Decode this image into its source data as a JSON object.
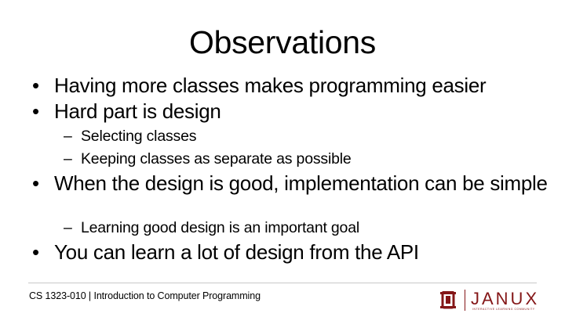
{
  "slide": {
    "title": "Observations",
    "items": [
      {
        "level": 1,
        "text": "Having more classes makes programming easier"
      },
      {
        "level": 1,
        "text": "Hard part is design"
      },
      {
        "level": 2,
        "text": "Selecting classes"
      },
      {
        "level": 2,
        "text": "Keeping classes as separate as possible"
      },
      {
        "level": 1,
        "text": "When the design is good, implementation can be simple"
      },
      {
        "level": 2,
        "text": "Learning good design is an important goal"
      },
      {
        "level": 1,
        "text": "You can learn a lot of design from the API"
      }
    ]
  },
  "footer": {
    "course": "CS 1323-010 | Introduction to Computer Programming",
    "logo_mark": "OU",
    "logo_word": "JANUX",
    "logo_tagline": "INTERACTIVE LEARNING COMMUNITY"
  },
  "colors": {
    "brand": "#841617",
    "text": "#000000",
    "divider": "#c8c8c8"
  },
  "icons": {
    "university": "ou-logo-icon"
  }
}
